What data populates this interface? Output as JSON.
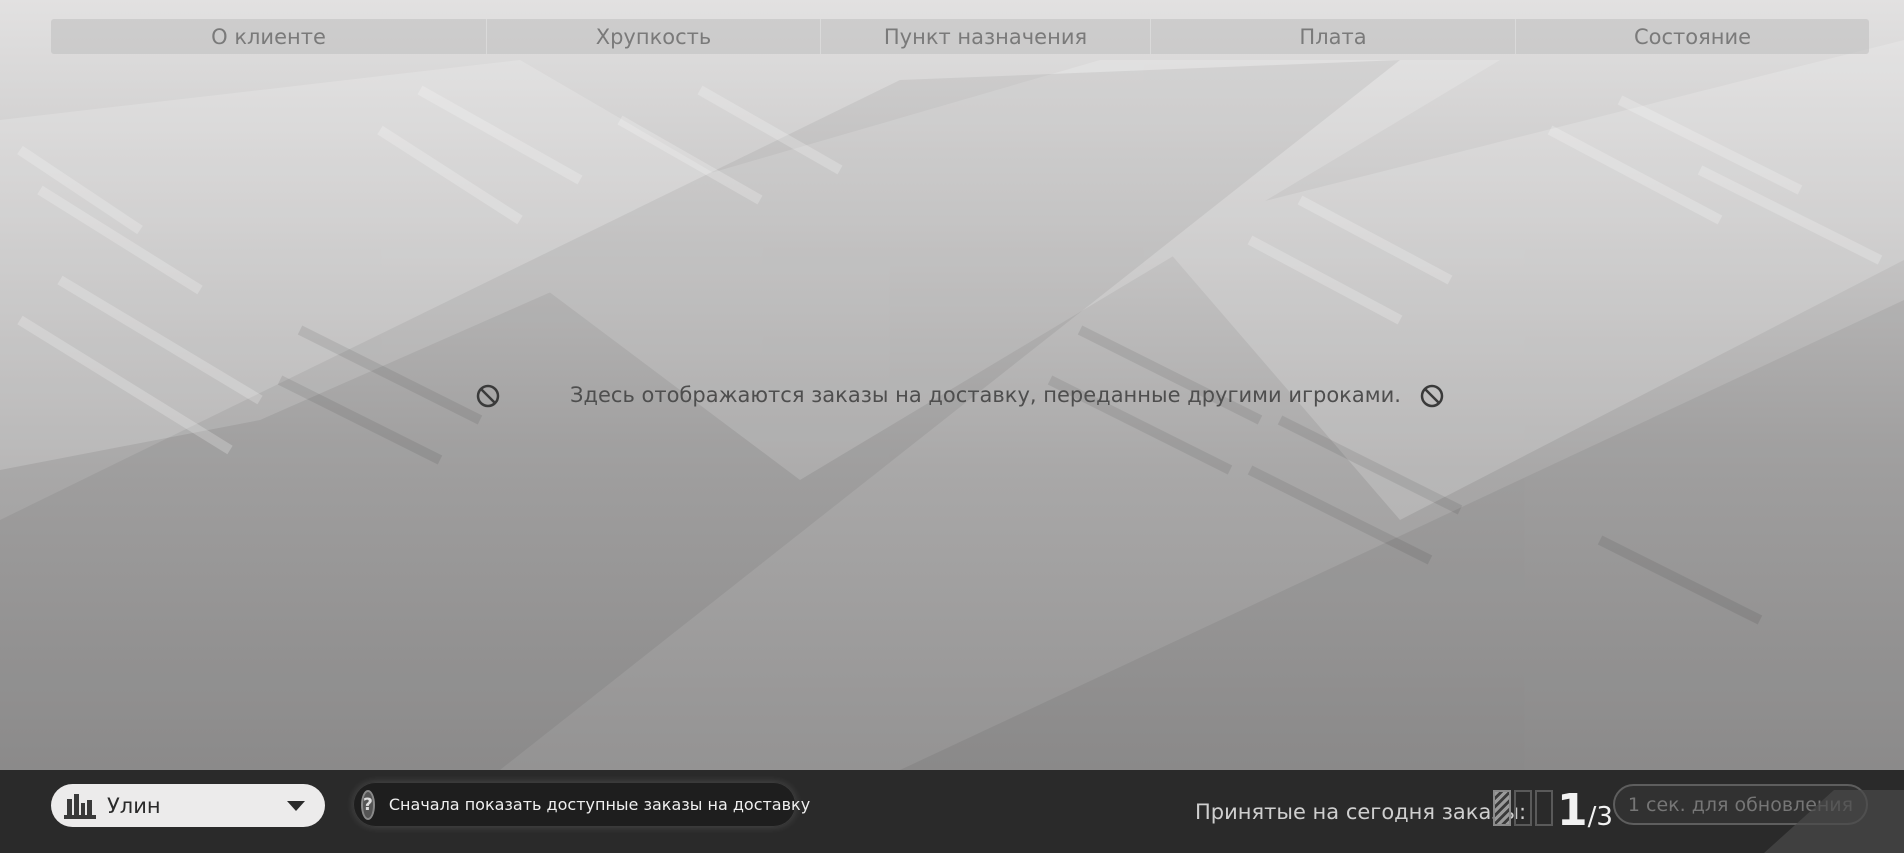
{
  "table": {
    "columns": [
      "О клиенте",
      "Хрупкость",
      "Пункт назначения",
      "Плата",
      "Состояние"
    ]
  },
  "empty_state": {
    "message": "Здесь отображаются заказы на доставку, переданные другими игроками.",
    "icon": "no-entry-icon"
  },
  "footer": {
    "location": {
      "label": "Улин",
      "icon": "city-skyline-icon"
    },
    "filter_toggle": {
      "icon": "question-icon",
      "label": "Сначала показать доступные заказы на доставку"
    },
    "accepted": {
      "label": "Принятые на сегодня заказы:",
      "current": "1",
      "max": "/3",
      "filled_slots": 1,
      "total_slots": 3
    },
    "refresh_label": "1 сек. для обновления"
  },
  "colors": {
    "footer_bg": "#2a2a2a",
    "header_text": "#7a7a7a",
    "message_text": "#4e4e4e"
  }
}
